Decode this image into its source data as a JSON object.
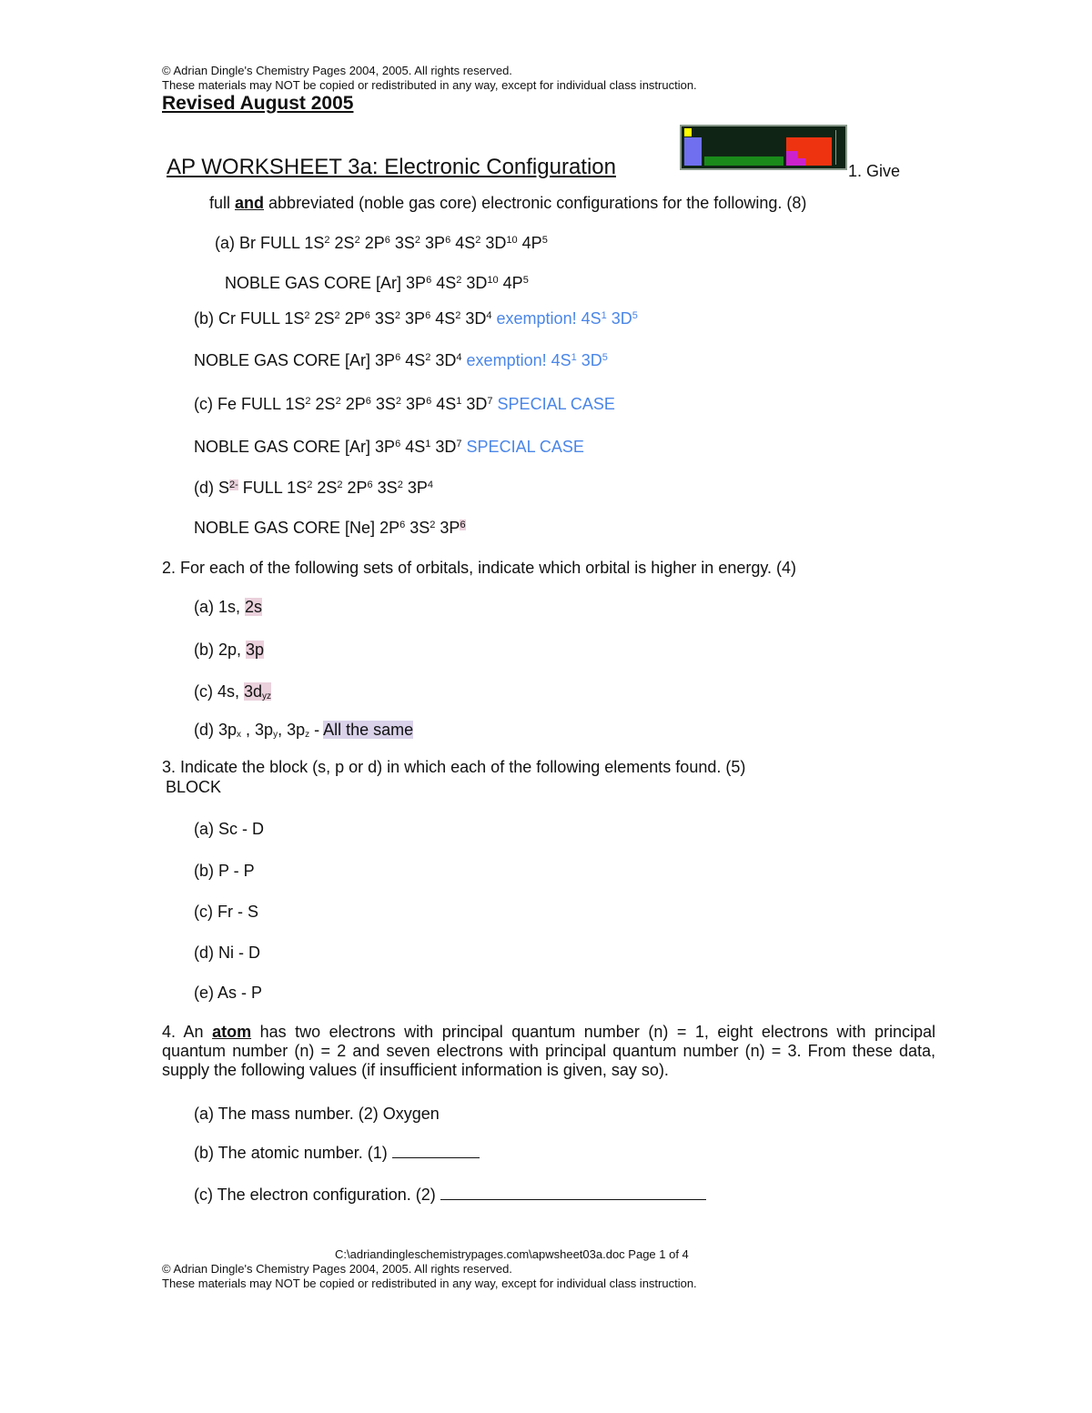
{
  "header": {
    "copyright": "© Adrian Dingle's Chemistry Pages 2004, 2005. All rights reserved.",
    "notice": "These materials may NOT be copied or redistributed in any way, except for individual class instruction.",
    "revised": "Revised August 2005"
  },
  "title": "AP WORKSHEET 3a: Electronic Configuration",
  "periodic_table_image": {
    "icon": "periodic-table-icon",
    "colors": {
      "background": "#0f2414",
      "s_block_h": "#ffff00",
      "s_block": "#6f6ff0",
      "d_block": "#1a8a1a",
      "p_block_metal": "#cc22cc",
      "p_block": "#ee3311"
    }
  },
  "q1": {
    "intro_tail": "1. Give",
    "line2_pre": "full ",
    "line2_emph": "and",
    "line2_post": " abbreviated (noble gas core) electronic configurations for the following. (8)",
    "a_full": {
      "label": "(a) Br FULL ",
      "terms": [
        [
          "1S",
          "2"
        ],
        [
          "2S",
          "2"
        ],
        [
          "2P",
          "6"
        ],
        [
          "3S",
          "2"
        ],
        [
          "3P",
          "6"
        ],
        [
          "4S",
          "2"
        ],
        [
          "3D",
          "10"
        ],
        [
          "4P",
          "5"
        ]
      ]
    },
    "a_core": {
      "label": "NOBLE GAS CORE [Ar] ",
      "terms": [
        [
          "3P",
          "6"
        ],
        [
          "4S",
          "2"
        ],
        [
          "3D",
          "10"
        ],
        [
          "4P",
          "5"
        ]
      ]
    },
    "b_full": {
      "label": "(b) Cr FULL ",
      "terms": [
        [
          "1S",
          "2"
        ],
        [
          "2S",
          "2"
        ],
        [
          "2P",
          "6"
        ],
        [
          "3S",
          "2"
        ],
        [
          "3P",
          "6"
        ],
        [
          "4S",
          "2"
        ],
        [
          "3D",
          "4"
        ]
      ],
      "note": "exemption! ",
      "note_terms": [
        [
          "4S",
          "1"
        ],
        [
          "3D",
          "5"
        ]
      ]
    },
    "b_core": {
      "label": "NOBLE GAS CORE [Ar] ",
      "terms": [
        [
          "3P",
          "6"
        ],
        [
          "4S",
          "2"
        ],
        [
          "3D",
          "4"
        ]
      ],
      "note": "exemption! ",
      "note_terms": [
        [
          "4S",
          "1"
        ],
        [
          "3D",
          "5"
        ]
      ]
    },
    "c_full": {
      "label": "(c) Fe FULL ",
      "terms": [
        [
          "1S",
          "2"
        ],
        [
          "2S",
          "2"
        ],
        [
          "2P",
          "6"
        ],
        [
          "3S",
          "2"
        ],
        [
          "3P",
          "6"
        ],
        [
          "4S",
          "1"
        ],
        [
          "3D",
          "7"
        ]
      ],
      "note": "SPECIAL CASE"
    },
    "c_core": {
      "label": "NOBLE GAS CORE [Ar] ",
      "terms": [
        [
          "3P",
          "6"
        ],
        [
          "4S",
          "1"
        ],
        [
          "3D",
          "7"
        ]
      ],
      "note": "SPECIAL CASE"
    },
    "d_full": {
      "label_pre": "(d) S",
      "charge": "2-",
      "label_post": " FULL ",
      "terms": [
        [
          "1S",
          "2"
        ],
        [
          "2S",
          "2"
        ],
        [
          "2P",
          "6"
        ],
        [
          "3S",
          "2"
        ],
        [
          "3P",
          "4"
        ]
      ]
    },
    "d_core": {
      "label": "NOBLE GAS CORE [Ne] ",
      "terms": [
        [
          "2P",
          "6"
        ],
        [
          "3S",
          "2"
        ]
      ],
      "last_base": "3P",
      "last_sup": "6"
    }
  },
  "q2": {
    "prompt": "2. For each of the following sets of orbitals, indicate which orbital is higher in energy. (4)",
    "a_pre": "(a) 1s, ",
    "a_ans": "2s",
    "b_pre": "(b) 2p, ",
    "b_ans": "3p",
    "c_pre": "(c) 4s, ",
    "c_ans": "3d",
    "c_sub": "yz",
    "d_pre": "(d) 3p",
    "d_x": "x",
    "d_mid1": " , 3p",
    "d_y": "y",
    "d_mid2": ", 3p",
    "d_z": "z",
    "d_dash": " - ",
    "d_ans": "All the same"
  },
  "q3": {
    "prompt": "3. Indicate the block (s, p or d) in which each of the following elements found. (5)",
    "block_label": "BLOCK",
    "items": [
      "(a) Sc - D",
      "(b) P - P",
      "(c) Fr - S",
      "(d) Ni - D",
      "(e) As - P"
    ]
  },
  "q4": {
    "pre": "4. An ",
    "emph": "atom",
    "post": " has two electrons with principal quantum number (n) = 1, eight electrons with principal quantum number (n) = 2 and seven electrons with principal quantum number (n) = 3. From these data, supply the following values (if insufficient information is given, say so).",
    "a": "(a) The mass number. (2) Oxygen",
    "b": "(b) The atomic number. (1) ",
    "c": "(c) The electron configuration. (2) "
  },
  "footer": {
    "path": "C:\\adriandingleschemistrypages.com\\apwsheet03a.doc Page 1 of 4",
    "copyright": "© Adrian Dingle's Chemistry Pages 2004, 2005. All rights reserved.",
    "notice": "These materials may NOT be copied or redistributed in any way, except for individual class instruction."
  }
}
